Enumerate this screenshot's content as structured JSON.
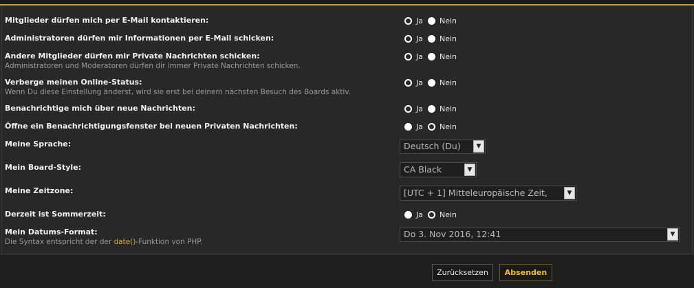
{
  "options": {
    "yes": "Ja",
    "no": "Nein"
  },
  "settings": [
    {
      "label": "Mitglieder dürfen mich per E-Mail kontaktieren:",
      "explain": "",
      "selected": "yes"
    },
    {
      "label": "Administratoren dürfen mir Informationen per E-Mail schicken:",
      "explain": "",
      "selected": "yes"
    },
    {
      "label": "Andere Mitglieder dürfen mir Private Nachrichten schicken:",
      "explain": "Administratoren und Moderatoren dürfen dir immer Private Nachrichten schicken.",
      "selected": "yes"
    },
    {
      "label": "Verberge meinen Online-Status:",
      "explain": "Wenn Du diese Einstellung änderst, wird sie erst bei deinem nächsten Besuch des Boards aktiv.",
      "selected": "yes"
    },
    {
      "label": "Benachrichtige mich über neue Nachrichten:",
      "explain": "",
      "selected": "yes"
    },
    {
      "label": "Öffne ein Benachrichtigungsfenster bei neuen Privaten Nachrichten:",
      "explain": "",
      "selected": "no"
    }
  ],
  "language": {
    "label": "Meine Sprache:",
    "value": "Deutsch (Du)"
  },
  "style": {
    "label": "Mein Board-Style:",
    "value": "CA Black"
  },
  "timezone": {
    "label": "Meine Zeitzone:",
    "value": "[UTC + 1] Mitteleuropäische Zeit,"
  },
  "dst": {
    "label": "Derzeit ist Sommerzeit:",
    "selected": "no"
  },
  "dateformat": {
    "label": "Mein Datums-Format:",
    "explain_pre": "Die Syntax entspricht der der ",
    "explain_link": "date()",
    "explain_post": "-Funktion von PHP.",
    "value": "Do 3. Nov 2016, 12:41"
  },
  "buttons": {
    "reset": "Zurücksetzen",
    "submit": "Absenden"
  },
  "icons": {
    "dropdown": "chevron-down-icon",
    "radio_on": "radio-selected-icon",
    "radio_off": "radio-unselected-icon"
  }
}
